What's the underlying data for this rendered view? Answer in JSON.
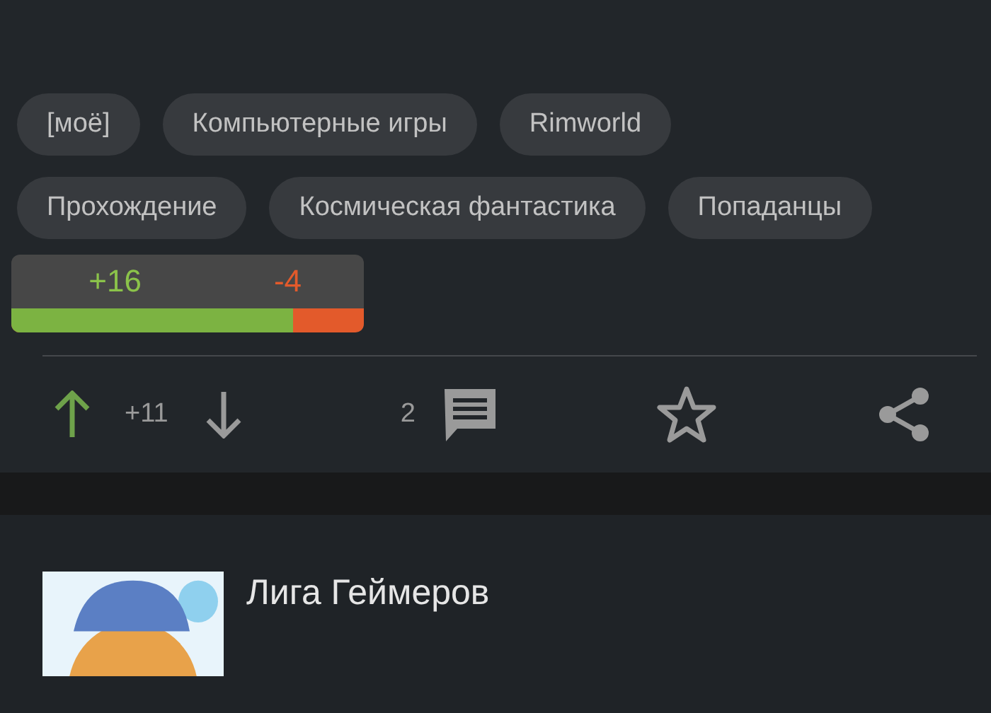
{
  "tags": [
    {
      "label": "[моё]"
    },
    {
      "label": "Компьютерные игры"
    },
    {
      "label": "Rimworld"
    },
    {
      "label": "Прохождение"
    },
    {
      "label": "Космическая фантастика"
    },
    {
      "label": "Попаданцы"
    }
  ],
  "rating": {
    "plus": "+16",
    "minus": "-4",
    "level": 0.8
  },
  "actions": {
    "upvoted": true,
    "downvoted": false,
    "score": "+11",
    "comments": "2",
    "saved": false
  },
  "next_post": {
    "community": "Лига Геймеров"
  }
}
